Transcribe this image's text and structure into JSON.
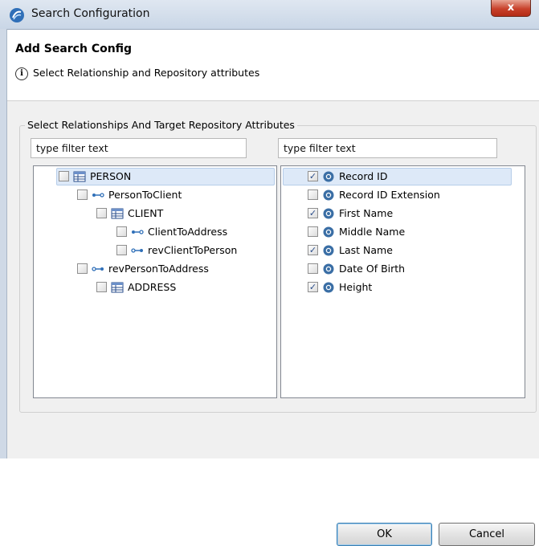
{
  "window": {
    "title": "Search Configuration",
    "close_glyph": "x",
    "app_icon": "swirl-logo-icon"
  },
  "header": {
    "title": "Add Search Config",
    "info_icon": "info-icon",
    "message": "Select Relationship and Repository attributes"
  },
  "group": {
    "label": "Select Relationships And Target Repository Attributes"
  },
  "left": {
    "filter_value": "type filter text",
    "items": [
      {
        "label": "PERSON",
        "icon": "table-icon",
        "checked": false,
        "selected": true
      },
      {
        "label": "PersonToClient",
        "icon": "forward-relationship-icon",
        "checked": false
      },
      {
        "label": "CLIENT",
        "icon": "table-icon",
        "checked": false
      },
      {
        "label": "ClientToAddress",
        "icon": "forward-relationship-icon",
        "checked": false
      },
      {
        "label": "revClientToPerson",
        "icon": "reverse-relationship-icon",
        "checked": false
      },
      {
        "label": "revPersonToAddress",
        "icon": "reverse-relationship-icon",
        "checked": false
      },
      {
        "label": "ADDRESS",
        "icon": "table-icon",
        "checked": false
      }
    ]
  },
  "right": {
    "filter_value": "type filter text",
    "items": [
      {
        "label": "Record ID",
        "icon": "attribute-icon",
        "checked": true,
        "selected": true
      },
      {
        "label": "Record ID Extension",
        "icon": "attribute-icon",
        "checked": false
      },
      {
        "label": "First Name",
        "icon": "attribute-icon",
        "checked": true
      },
      {
        "label": "Middle Name",
        "icon": "attribute-icon",
        "checked": false
      },
      {
        "label": "Last Name",
        "icon": "attribute-icon",
        "checked": true
      },
      {
        "label": "Date Of Birth",
        "icon": "attribute-icon",
        "checked": false
      },
      {
        "label": "Height",
        "icon": "attribute-icon",
        "checked": true
      }
    ]
  },
  "buttons": {
    "ok": "OK",
    "cancel": "Cancel"
  },
  "colors": {
    "selection": "#dde9f8",
    "attribute": "#3a6ea5",
    "titlebar": "#c9d6e6"
  }
}
